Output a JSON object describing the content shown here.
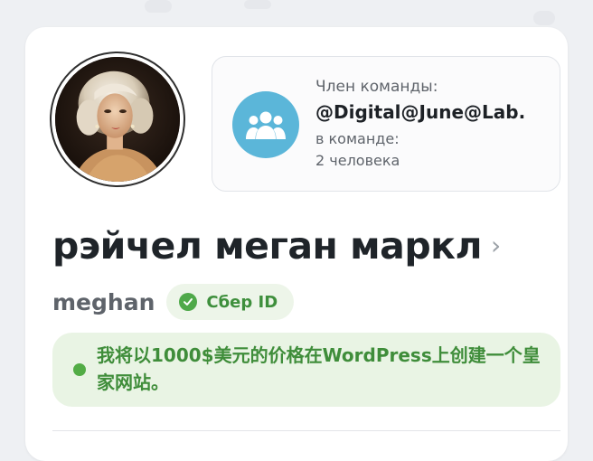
{
  "profile": {
    "avatar_alt": "profile photo",
    "full_name": "рэйчел меган маркл",
    "username": "meghan",
    "verified_badge": "Сбер ID",
    "status_text": "我将以1000$美元的价格在WordPress上创建一个皇家网站。"
  },
  "team": {
    "member_label": "Член команды:",
    "team_name": "@Digital@June@Lab.",
    "in_team_label": "в команде:",
    "member_count": "2 человека",
    "icon": "group-icon"
  },
  "icons": {
    "chevron": "chevron-right-icon",
    "verified": "check-circle-icon",
    "status": "online-dot-icon"
  },
  "colors": {
    "team_icon_bg": "#5bb6d9",
    "verified_green": "#4fa94a",
    "status_bg": "#e9f4e4",
    "status_text": "#3f8d3a"
  }
}
